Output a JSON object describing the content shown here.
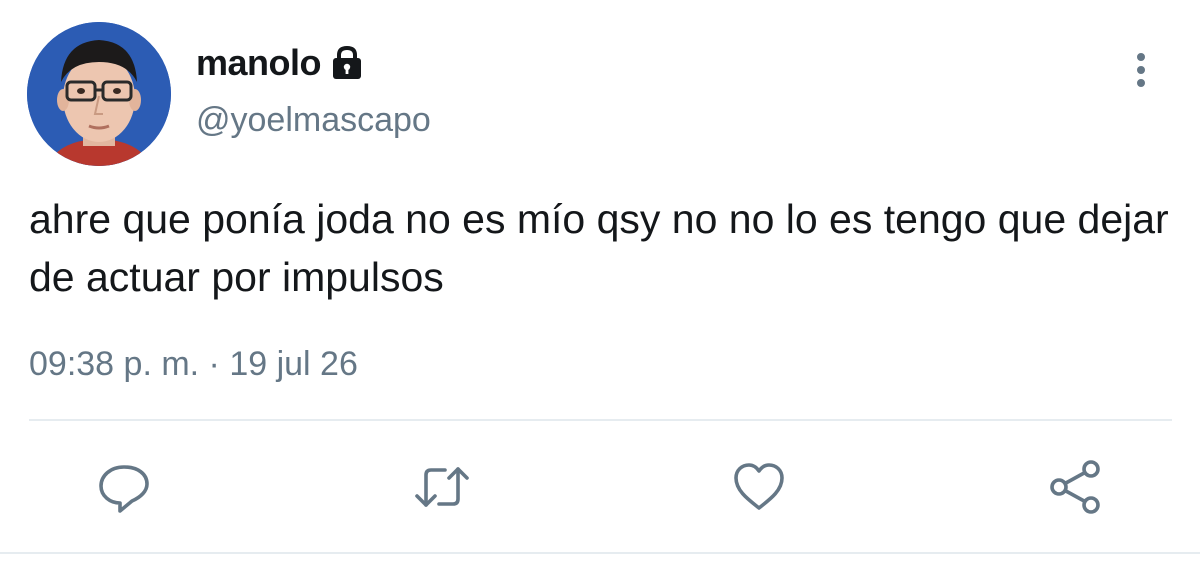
{
  "tweet": {
    "display_name": "manolo",
    "handle": "@yoelmascapo",
    "text": "ahre que ponía joda no es mío qsy no no lo es tengo que dejar de actuar por impulsos",
    "time": "09:38 p. m.",
    "separator": " · ",
    "date": "19 jul 26",
    "protected_icon": "lock-icon",
    "avatar_icon": "profile-photo"
  },
  "actions": [
    {
      "name": "reply",
      "icon": "reply-icon"
    },
    {
      "name": "retweet",
      "icon": "retweet-icon"
    },
    {
      "name": "like",
      "icon": "heart-icon"
    },
    {
      "name": "share",
      "icon": "share-icon"
    }
  ],
  "colors": {
    "text": "#14171a",
    "secondary": "#657786",
    "divider": "#e6ecf0",
    "background": "#ffffff"
  }
}
